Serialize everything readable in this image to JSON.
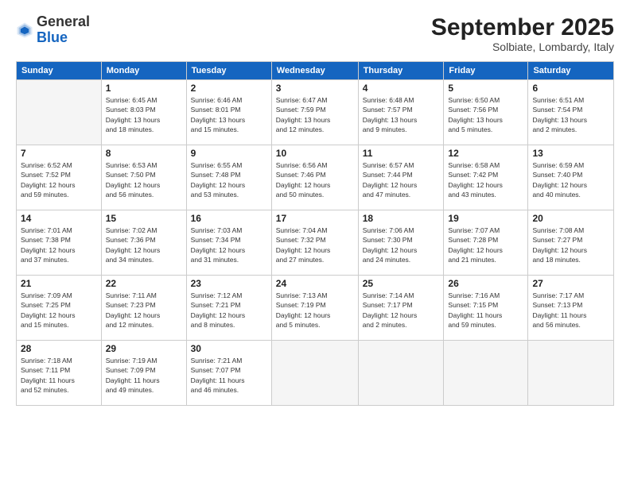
{
  "header": {
    "logo_general": "General",
    "logo_blue": "Blue",
    "month_title": "September 2025",
    "subtitle": "Solbiate, Lombardy, Italy"
  },
  "days_of_week": [
    "Sunday",
    "Monday",
    "Tuesday",
    "Wednesday",
    "Thursday",
    "Friday",
    "Saturday"
  ],
  "weeks": [
    [
      {
        "day": "",
        "info": ""
      },
      {
        "day": "1",
        "info": "Sunrise: 6:45 AM\nSunset: 8:03 PM\nDaylight: 13 hours\nand 18 minutes."
      },
      {
        "day": "2",
        "info": "Sunrise: 6:46 AM\nSunset: 8:01 PM\nDaylight: 13 hours\nand 15 minutes."
      },
      {
        "day": "3",
        "info": "Sunrise: 6:47 AM\nSunset: 7:59 PM\nDaylight: 13 hours\nand 12 minutes."
      },
      {
        "day": "4",
        "info": "Sunrise: 6:48 AM\nSunset: 7:57 PM\nDaylight: 13 hours\nand 9 minutes."
      },
      {
        "day": "5",
        "info": "Sunrise: 6:50 AM\nSunset: 7:56 PM\nDaylight: 13 hours\nand 5 minutes."
      },
      {
        "day": "6",
        "info": "Sunrise: 6:51 AM\nSunset: 7:54 PM\nDaylight: 13 hours\nand 2 minutes."
      }
    ],
    [
      {
        "day": "7",
        "info": "Sunrise: 6:52 AM\nSunset: 7:52 PM\nDaylight: 12 hours\nand 59 minutes."
      },
      {
        "day": "8",
        "info": "Sunrise: 6:53 AM\nSunset: 7:50 PM\nDaylight: 12 hours\nand 56 minutes."
      },
      {
        "day": "9",
        "info": "Sunrise: 6:55 AM\nSunset: 7:48 PM\nDaylight: 12 hours\nand 53 minutes."
      },
      {
        "day": "10",
        "info": "Sunrise: 6:56 AM\nSunset: 7:46 PM\nDaylight: 12 hours\nand 50 minutes."
      },
      {
        "day": "11",
        "info": "Sunrise: 6:57 AM\nSunset: 7:44 PM\nDaylight: 12 hours\nand 47 minutes."
      },
      {
        "day": "12",
        "info": "Sunrise: 6:58 AM\nSunset: 7:42 PM\nDaylight: 12 hours\nand 43 minutes."
      },
      {
        "day": "13",
        "info": "Sunrise: 6:59 AM\nSunset: 7:40 PM\nDaylight: 12 hours\nand 40 minutes."
      }
    ],
    [
      {
        "day": "14",
        "info": "Sunrise: 7:01 AM\nSunset: 7:38 PM\nDaylight: 12 hours\nand 37 minutes."
      },
      {
        "day": "15",
        "info": "Sunrise: 7:02 AM\nSunset: 7:36 PM\nDaylight: 12 hours\nand 34 minutes."
      },
      {
        "day": "16",
        "info": "Sunrise: 7:03 AM\nSunset: 7:34 PM\nDaylight: 12 hours\nand 31 minutes."
      },
      {
        "day": "17",
        "info": "Sunrise: 7:04 AM\nSunset: 7:32 PM\nDaylight: 12 hours\nand 27 minutes."
      },
      {
        "day": "18",
        "info": "Sunrise: 7:06 AM\nSunset: 7:30 PM\nDaylight: 12 hours\nand 24 minutes."
      },
      {
        "day": "19",
        "info": "Sunrise: 7:07 AM\nSunset: 7:28 PM\nDaylight: 12 hours\nand 21 minutes."
      },
      {
        "day": "20",
        "info": "Sunrise: 7:08 AM\nSunset: 7:27 PM\nDaylight: 12 hours\nand 18 minutes."
      }
    ],
    [
      {
        "day": "21",
        "info": "Sunrise: 7:09 AM\nSunset: 7:25 PM\nDaylight: 12 hours\nand 15 minutes."
      },
      {
        "day": "22",
        "info": "Sunrise: 7:11 AM\nSunset: 7:23 PM\nDaylight: 12 hours\nand 12 minutes."
      },
      {
        "day": "23",
        "info": "Sunrise: 7:12 AM\nSunset: 7:21 PM\nDaylight: 12 hours\nand 8 minutes."
      },
      {
        "day": "24",
        "info": "Sunrise: 7:13 AM\nSunset: 7:19 PM\nDaylight: 12 hours\nand 5 minutes."
      },
      {
        "day": "25",
        "info": "Sunrise: 7:14 AM\nSunset: 7:17 PM\nDaylight: 12 hours\nand 2 minutes."
      },
      {
        "day": "26",
        "info": "Sunrise: 7:16 AM\nSunset: 7:15 PM\nDaylight: 11 hours\nand 59 minutes."
      },
      {
        "day": "27",
        "info": "Sunrise: 7:17 AM\nSunset: 7:13 PM\nDaylight: 11 hours\nand 56 minutes."
      }
    ],
    [
      {
        "day": "28",
        "info": "Sunrise: 7:18 AM\nSunset: 7:11 PM\nDaylight: 11 hours\nand 52 minutes."
      },
      {
        "day": "29",
        "info": "Sunrise: 7:19 AM\nSunset: 7:09 PM\nDaylight: 11 hours\nand 49 minutes."
      },
      {
        "day": "30",
        "info": "Sunrise: 7:21 AM\nSunset: 7:07 PM\nDaylight: 11 hours\nand 46 minutes."
      },
      {
        "day": "",
        "info": ""
      },
      {
        "day": "",
        "info": ""
      },
      {
        "day": "",
        "info": ""
      },
      {
        "day": "",
        "info": ""
      }
    ]
  ]
}
